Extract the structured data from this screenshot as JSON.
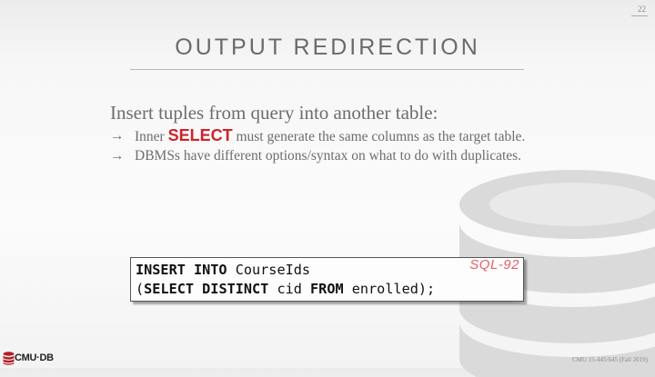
{
  "page_number": "22",
  "title": "OUTPUT REDIRECTION",
  "lead": "Insert tuples from query into another table:",
  "bullets": [
    {
      "arrow": "→",
      "pre": "Inner ",
      "keyword": "SELECT",
      "post": " must generate the same columns as the target table."
    },
    {
      "arrow": "→",
      "text": "DBMSs have different options/syntax on what to do with duplicates."
    }
  ],
  "code": {
    "line1_kw": "INSERT INTO",
    "line1_rest": " CourseIds",
    "line2_open": "(",
    "line2_kw1": "SELECT DISTINCT",
    "line2_mid": " cid ",
    "line2_kw2": "FROM",
    "line2_rest": " enrolled);",
    "tag": "SQL-92"
  },
  "footer": {
    "logo_text": "CMU·DB",
    "course": "CMU 15-445/645 (Fall 2019)"
  },
  "colors": {
    "keyword_red": "#d0222a",
    "sql_tag": "#e4606a",
    "logo_red": "#b01f25"
  },
  "icons": {
    "logo": "database-stack-icon",
    "watermark": "database-cylinder-icon"
  }
}
